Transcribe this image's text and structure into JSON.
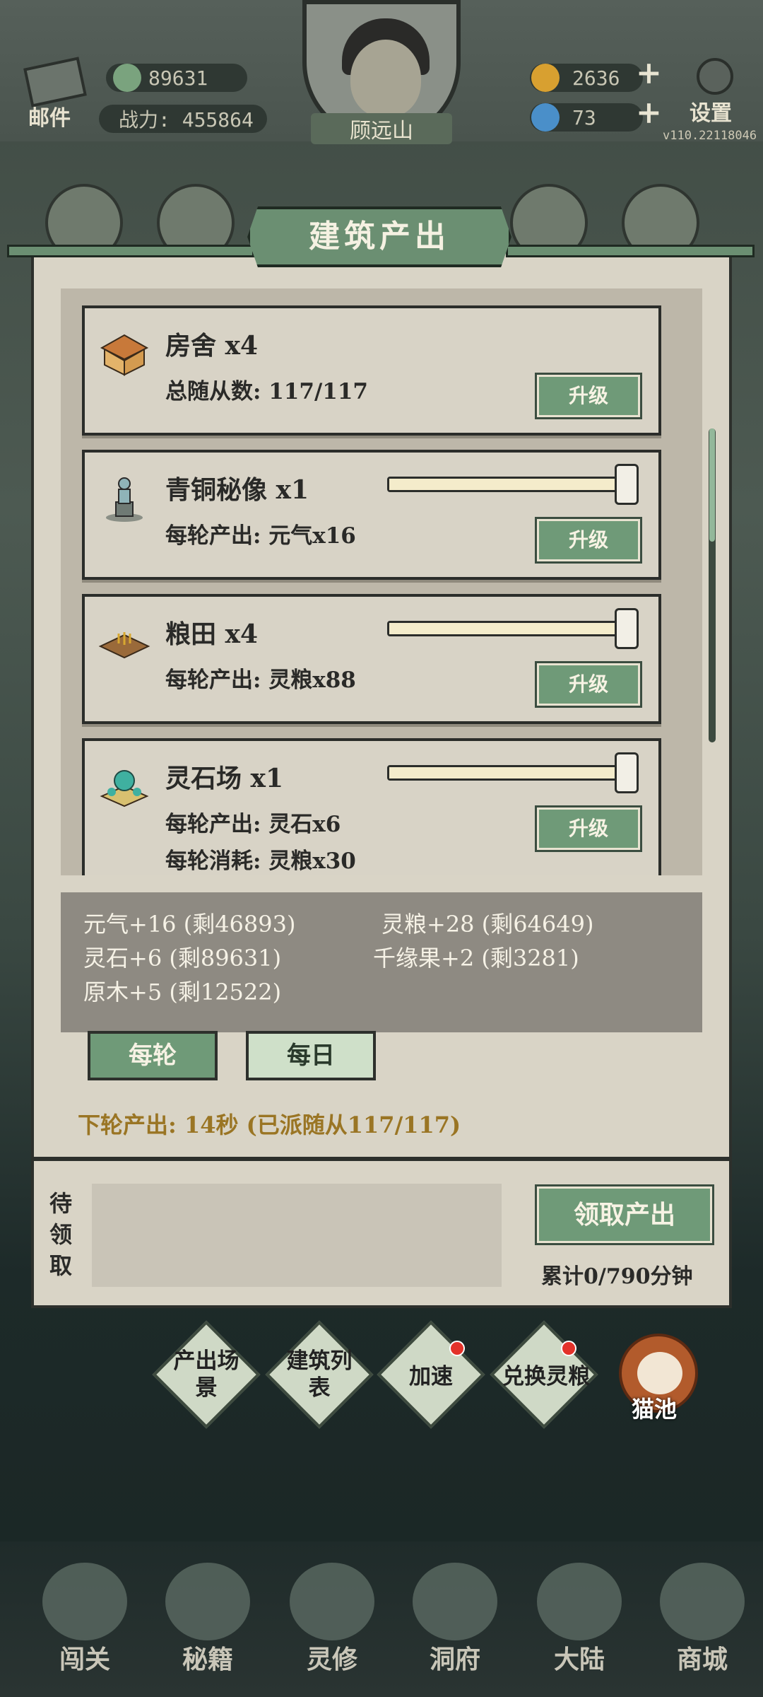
{
  "header": {
    "mail_label": "邮件",
    "spirit_stone": "89631",
    "power": "战力: 455864",
    "player_name": "顾远山",
    "gold": "2636",
    "energy": "73",
    "settings_label": "设置",
    "version": "v110.22118046"
  },
  "panel": {
    "title": "建筑产出",
    "buildings": [
      {
        "name": "房舍 x4",
        "line1": "总随从数: 117/117",
        "line2": "",
        "upgrade": "升级",
        "has_slider": false
      },
      {
        "name": "青铜秘像 x1",
        "line1": "每轮产出: 元气x16",
        "line2": "",
        "upgrade": "升级",
        "has_slider": true,
        "slider_level": 1.0
      },
      {
        "name": "粮田 x4",
        "line1": "每轮产出: 灵粮x88",
        "line2": "",
        "upgrade": "升级",
        "has_slider": true,
        "slider_level": 1.0
      },
      {
        "name": "灵石场 x1",
        "line1": "每轮产出: 灵石x6",
        "line2": "每轮消耗: 灵粮x30",
        "upgrade": "升级",
        "has_slider": true,
        "slider_level": 1.0
      }
    ],
    "summary": [
      "元气+16 (剩46893)",
      "灵粮+28 (剩64649)",
      "灵石+6 (剩89631)",
      "千缘果+2 (剩3281)",
      "原木+5 (剩12522)"
    ],
    "tab_per_round": "每轮",
    "tab_per_day": "每日",
    "next_output": "下轮产出: 14秒 (已派随从117/117)"
  },
  "pending": {
    "label": "待领取",
    "claim_button": "领取产出",
    "accumulated": "累计0/790分钟"
  },
  "actions": [
    {
      "label": "产出场景",
      "red_dot": false
    },
    {
      "label": "建筑列表",
      "red_dot": false
    },
    {
      "label": "加速",
      "red_dot": true
    },
    {
      "label": "兑换灵粮",
      "red_dot": true
    }
  ],
  "cat_pool_label": "猫池",
  "nav": [
    "闯关",
    "秘籍",
    "灵修",
    "洞府",
    "大陆",
    "商城"
  ],
  "colors": {
    "accent_green": "#6f9a78",
    "panel_bg": "#d9d4c6",
    "gold_text": "#9a7524"
  }
}
